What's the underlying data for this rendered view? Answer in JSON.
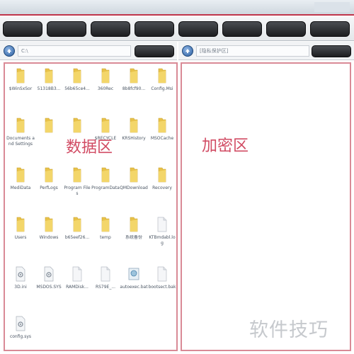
{
  "titlebar": {
    "text": ""
  },
  "toolbar": {
    "buttons": [
      "",
      "",
      "",
      "",
      "",
      "",
      "",
      ""
    ]
  },
  "left_pane": {
    "path": "C:\\",
    "button_label": "",
    "region_label": "数据区",
    "items": [
      {
        "name": "$WinSxSor",
        "type": "folder"
      },
      {
        "name": "51318B3...",
        "type": "folder"
      },
      {
        "name": "56b65ce4...",
        "type": "folder"
      },
      {
        "name": "360Rec",
        "type": "folder"
      },
      {
        "name": "8b8fcf90...",
        "type": "folder"
      },
      {
        "name": "Config.Msi",
        "type": "folder"
      },
      {
        "name": "Documents and Settings",
        "type": "folder"
      },
      {
        "name": "",
        "type": "folder"
      },
      {
        "name": "",
        "type": "folder"
      },
      {
        "name": "$RECYCLE",
        "type": "folder"
      },
      {
        "name": "KRSHistory",
        "type": "folder"
      },
      {
        "name": "MSOCache",
        "type": "folder"
      },
      {
        "name": "MediData",
        "type": "folder"
      },
      {
        "name": "PerfLogs",
        "type": "folder"
      },
      {
        "name": "Program Files",
        "type": "folder"
      },
      {
        "name": "ProgramData",
        "type": "folder"
      },
      {
        "name": "QMDownload",
        "type": "folder"
      },
      {
        "name": "Recovery",
        "type": "folder"
      },
      {
        "name": "Users",
        "type": "folder"
      },
      {
        "name": "Windows",
        "type": "folder"
      },
      {
        "name": "b65eef26...",
        "type": "folder"
      },
      {
        "name": "temp",
        "type": "folder"
      },
      {
        "name": "系统备份",
        "type": "folder"
      },
      {
        "name": "KTBmdabl.log",
        "type": "file"
      },
      {
        "name": "3D.ini",
        "type": "config"
      },
      {
        "name": "MSDOS.SYS",
        "type": "config"
      },
      {
        "name": "RAMDisk...",
        "type": "file"
      },
      {
        "name": "RS79E_...",
        "type": "file"
      },
      {
        "name": "autoexec.bat",
        "type": "image"
      },
      {
        "name": "bootsect.bak",
        "type": "file"
      },
      {
        "name": "config.sys",
        "type": "config"
      }
    ]
  },
  "right_pane": {
    "path": "[隐私保护区]",
    "button_label": "",
    "region_label": "加密区"
  },
  "watermark": "软件技巧",
  "colors": {
    "accent": "#c0344a",
    "panel_border": "#d98a96",
    "region_label": "#d14b63",
    "folder": "#e8c24a"
  }
}
